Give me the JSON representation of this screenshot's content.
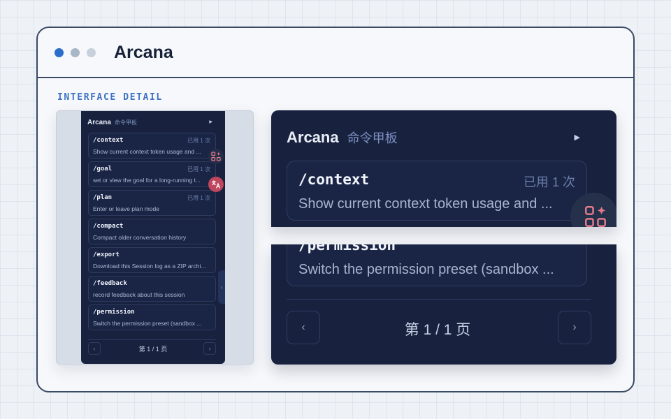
{
  "window": {
    "title": "Arcana",
    "section_label": "INTERFACE DETAIL"
  },
  "palette": {
    "name": "Arcana",
    "subtitle": "命令甲板",
    "collapse_icon": "triangle-right-icon",
    "items": [
      {
        "command": "/context",
        "used": "已用 1 次",
        "description": "Show current context token usage and ..."
      },
      {
        "command": "/goal",
        "used": "已用 1 次",
        "description": "set or view the goal for a long-running t..."
      },
      {
        "command": "/plan",
        "used": "已用 1 次",
        "description": "Enter or leave plan mode"
      },
      {
        "command": "/compact",
        "used": "",
        "description": "Compact older conversation history"
      },
      {
        "command": "/export",
        "used": "",
        "description": "Download this Session log as a ZIP archi..."
      },
      {
        "command": "/feedback",
        "used": "",
        "description": "record feedback about this session"
      },
      {
        "command": "/permission",
        "used": "",
        "description": "Switch the permission preset (sandbox ..."
      }
    ],
    "pagination": {
      "prev": "‹",
      "next": "›",
      "label": "第 1 / 1 页"
    },
    "floating_buttons": [
      "apps-sparkle-icon",
      "translate-icon"
    ],
    "side_handle": "›"
  },
  "zoom": {
    "permission_command_partial": "/permission",
    "permission_description": "Switch the permission preset (sandbox ..."
  },
  "colors": {
    "accent": "#2c6ecb",
    "panel_bg": "#18223f",
    "translate_badge": "#c0465d",
    "apps_icon": "#e07a8a"
  }
}
